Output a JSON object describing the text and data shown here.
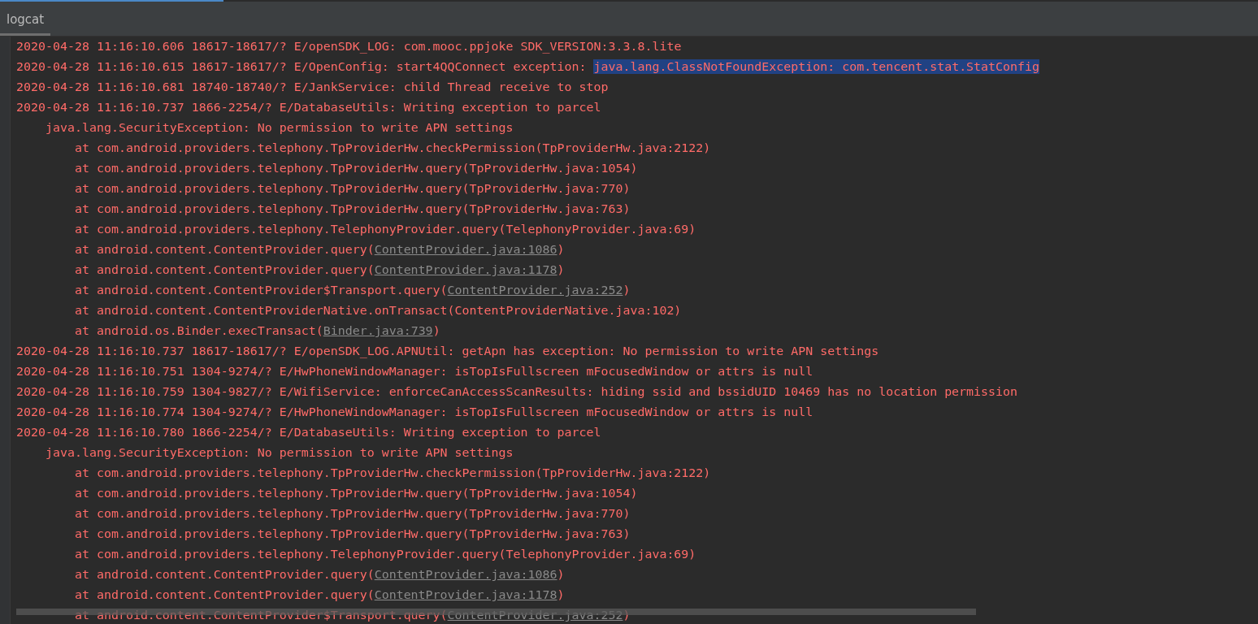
{
  "tab": {
    "label": "logcat"
  },
  "lines": [
    {
      "kind": "entry",
      "text": "2020-04-28 11:16:10.606 18617-18617/? E/openSDK_LOG: com.mooc.ppjoke SDK_VERSION:3.3.8.lite"
    },
    {
      "kind": "entry",
      "text": "2020-04-28 11:16:10.615 18617-18617/? E/OpenConfig: start4QQConnect exception: ",
      "selection": "java.lang.ClassNotFoundException: com.tencent.stat.StatConfig"
    },
    {
      "kind": "entry",
      "text": "2020-04-28 11:16:10.681 18740-18740/? E/JankService: child Thread receive to stop"
    },
    {
      "kind": "entry",
      "text": "2020-04-28 11:16:10.737 1866-2254/? E/DatabaseUtils: Writing exception to parcel"
    },
    {
      "kind": "exception",
      "text": "java.lang.SecurityException: No permission to write APN settings"
    },
    {
      "kind": "frame",
      "text": "at com.android.providers.telephony.TpProviderHw.checkPermission(TpProviderHw.java:2122)"
    },
    {
      "kind": "frame",
      "text": "at com.android.providers.telephony.TpProviderHw.query(TpProviderHw.java:1054)"
    },
    {
      "kind": "frame",
      "text": "at com.android.providers.telephony.TpProviderHw.query(TpProviderHw.java:770)"
    },
    {
      "kind": "frame",
      "text": "at com.android.providers.telephony.TpProviderHw.query(TpProviderHw.java:763)"
    },
    {
      "kind": "frame",
      "text": "at com.android.providers.telephony.TelephonyProvider.query(TelephonyProvider.java:69)"
    },
    {
      "kind": "frame",
      "text": "at android.content.ContentProvider.query(",
      "link": "ContentProvider.java:1086",
      "suffix": ")"
    },
    {
      "kind": "frame",
      "text": "at android.content.ContentProvider.query(",
      "link": "ContentProvider.java:1178",
      "suffix": ")"
    },
    {
      "kind": "frame",
      "text": "at android.content.ContentProvider$Transport.query(",
      "link": "ContentProvider.java:252",
      "suffix": ")"
    },
    {
      "kind": "frame",
      "text": "at android.content.ContentProviderNative.onTransact(ContentProviderNative.java:102)"
    },
    {
      "kind": "frame",
      "text": "at android.os.Binder.execTransact(",
      "link": "Binder.java:739",
      "suffix": ")"
    },
    {
      "kind": "entry",
      "text": "2020-04-28 11:16:10.737 18617-18617/? E/openSDK_LOG.APNUtil: getApn has exception: No permission to write APN settings"
    },
    {
      "kind": "entry",
      "text": "2020-04-28 11:16:10.751 1304-9274/? E/HwPhoneWindowManager: isTopIsFullscreen mFocusedWindow or attrs is null"
    },
    {
      "kind": "entry",
      "text": "2020-04-28 11:16:10.759 1304-9827/? E/WifiService: enforceCanAccessScanResults: hiding ssid and bssidUID 10469 has no location permission"
    },
    {
      "kind": "entry",
      "text": "2020-04-28 11:16:10.774 1304-9274/? E/HwPhoneWindowManager: isTopIsFullscreen mFocusedWindow or attrs is null"
    },
    {
      "kind": "entry",
      "text": "2020-04-28 11:16:10.780 1866-2254/? E/DatabaseUtils: Writing exception to parcel"
    },
    {
      "kind": "exception",
      "text": "java.lang.SecurityException: No permission to write APN settings"
    },
    {
      "kind": "frame",
      "text": "at com.android.providers.telephony.TpProviderHw.checkPermission(TpProviderHw.java:2122)"
    },
    {
      "kind": "frame",
      "text": "at com.android.providers.telephony.TpProviderHw.query(TpProviderHw.java:1054)"
    },
    {
      "kind": "frame",
      "text": "at com.android.providers.telephony.TpProviderHw.query(TpProviderHw.java:770)"
    },
    {
      "kind": "frame",
      "text": "at com.android.providers.telephony.TpProviderHw.query(TpProviderHw.java:763)"
    },
    {
      "kind": "frame",
      "text": "at com.android.providers.telephony.TelephonyProvider.query(TelephonyProvider.java:69)"
    },
    {
      "kind": "frame",
      "text": "at android.content.ContentProvider.query(",
      "link": "ContentProvider.java:1086",
      "suffix": ")"
    },
    {
      "kind": "frame",
      "text": "at android.content.ContentProvider.query(",
      "link": "ContentProvider.java:1178",
      "suffix": ")"
    },
    {
      "kind": "frame",
      "text": "at android.content.ContentProvider$Transport.query(",
      "link": "ContentProvider.java:252",
      "suffix": ")"
    }
  ]
}
